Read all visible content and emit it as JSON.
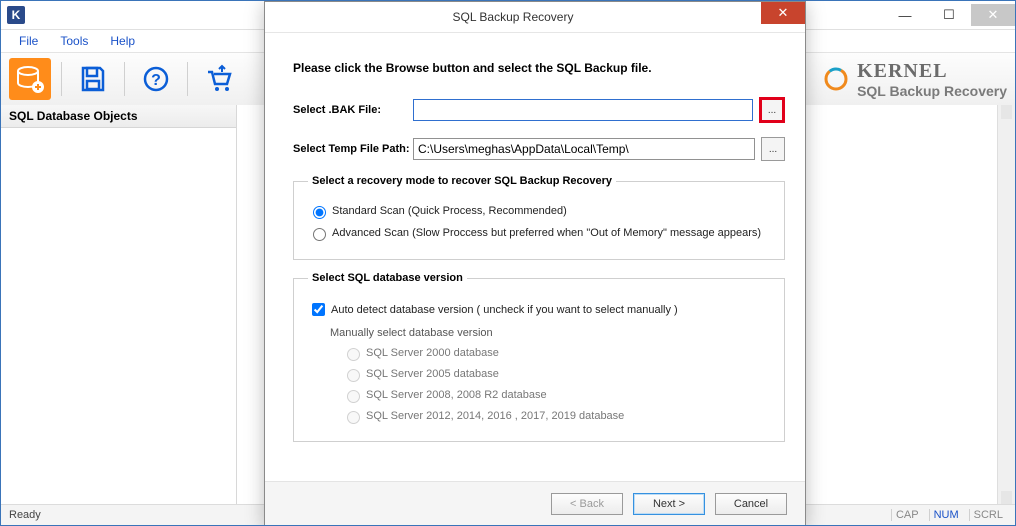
{
  "window": {
    "app_initial": "K",
    "min_glyph": "—",
    "max_glyph": "☐",
    "close_glyph": "✕"
  },
  "menu": {
    "file": "File",
    "tools": "Tools",
    "help": "Help"
  },
  "brand": {
    "name": "KERNEL",
    "product": "SQL Backup Recovery"
  },
  "left_pane": {
    "header": "SQL Database Objects"
  },
  "status": {
    "ready": "Ready",
    "caps": "CAP",
    "num": "NUM",
    "scrl": "SCRL"
  },
  "dialog": {
    "title": "SQL Backup Recovery",
    "close_glyph": "✕",
    "instruction": "Please click the Browse button and select the SQL Backup file.",
    "select_bak_label": "Select .BAK File:",
    "bak_value": "",
    "temp_path_label": "Select Temp File Path:",
    "temp_path_value": "C:\\Users\\meghas\\AppData\\Local\\Temp\\",
    "browse_glyph": "...",
    "recovery_legend": "Select a recovery mode to recover SQL Backup Recovery",
    "standard_scan": "Standard Scan (Quick Process, Recommended)",
    "advanced_scan": "Advanced Scan (Slow Proccess but preferred when \"Out of Memory\" message appears)",
    "version_legend": "Select SQL database version",
    "auto_detect": "Auto detect database version ( uncheck if you want to select manually )",
    "manual_label": "Manually select database version",
    "versions": [
      "SQL Server 2000 database",
      "SQL Server 2005 database",
      "SQL Server 2008, 2008 R2 database",
      "SQL Server 2012, 2014, 2016 , 2017, 2019 database"
    ],
    "back": "< Back",
    "next": "Next >",
    "cancel": "Cancel"
  }
}
